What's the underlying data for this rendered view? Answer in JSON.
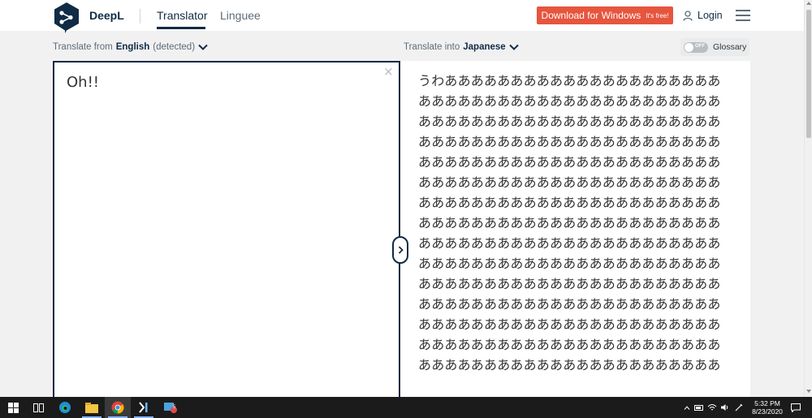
{
  "header": {
    "brand": "DeepL",
    "tabs": [
      {
        "label": "Translator"
      },
      {
        "label": "Linguee"
      }
    ],
    "download_label": "Download for Windows",
    "download_badge": "It's free!",
    "login_label": "Login"
  },
  "source": {
    "prefix": "Translate from",
    "language": "English",
    "detected": "(detected)",
    "text": "Oh!!",
    "clear": "×"
  },
  "target": {
    "prefix": "Translate into",
    "language": "Japanese",
    "glossary_toggle": "OFF",
    "glossary_label": "Glossary",
    "text": "うわあああああああああああああああああああああああああああああああああああああああああああああああああああああああああああああああああああああああああああああああああああああああああああああああああああああああああああああああああああああああああああああああああああああああああああああああああああああああああああああああああああああああああああああああああああああああああああああああああああああああああああああああああああああああああああああああああああああああああああああああああああああああああああああああああああああああああああああああああああああああああああああああああああああああああああああああああああああああああああああああああああああああああああああああああああああああ"
  },
  "taskbar": {
    "time": "5:32 PM",
    "date": "8/23/2020",
    "mail_badge": "5"
  }
}
